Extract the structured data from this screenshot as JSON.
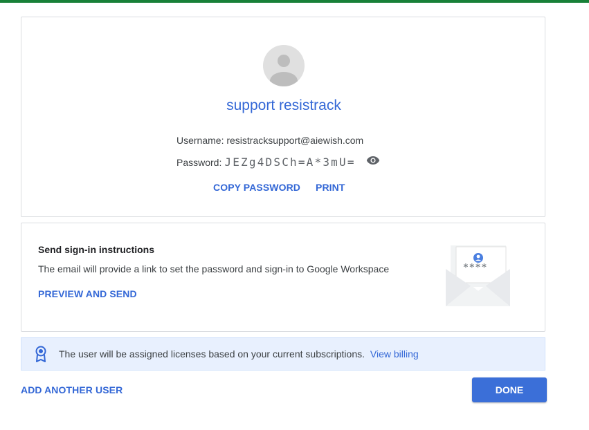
{
  "colors": {
    "top_bar": "#188038",
    "accent": "#3367d6",
    "done_button": "#3b6fd8",
    "banner_bg": "#e8f0fe"
  },
  "user_card": {
    "avatar_icon": "person-avatar-icon",
    "name": "support resistrack",
    "username_label": "Username:",
    "username_value": "resistracksupport@aiewish.com",
    "password_label": "Password:",
    "password_value": "JEZg4DSCh=A*3mU=",
    "reveal_icon": "eye-icon",
    "copy_password_label": "COPY PASSWORD",
    "print_label": "PRINT"
  },
  "send_card": {
    "title": "Send sign-in instructions",
    "description": "The email will provide a link to set the password and sign-in to Google Workspace",
    "preview_send_label": "PREVIEW AND SEND",
    "illustration": "envelope-password-illustration",
    "illustration_text": "****"
  },
  "banner": {
    "icon": "license-badge-icon",
    "text": "The user will be assigned licenses based on your current subscriptions.",
    "link_label": "View billing"
  },
  "footer": {
    "add_another_label": "ADD ANOTHER USER",
    "done_label": "DONE"
  }
}
